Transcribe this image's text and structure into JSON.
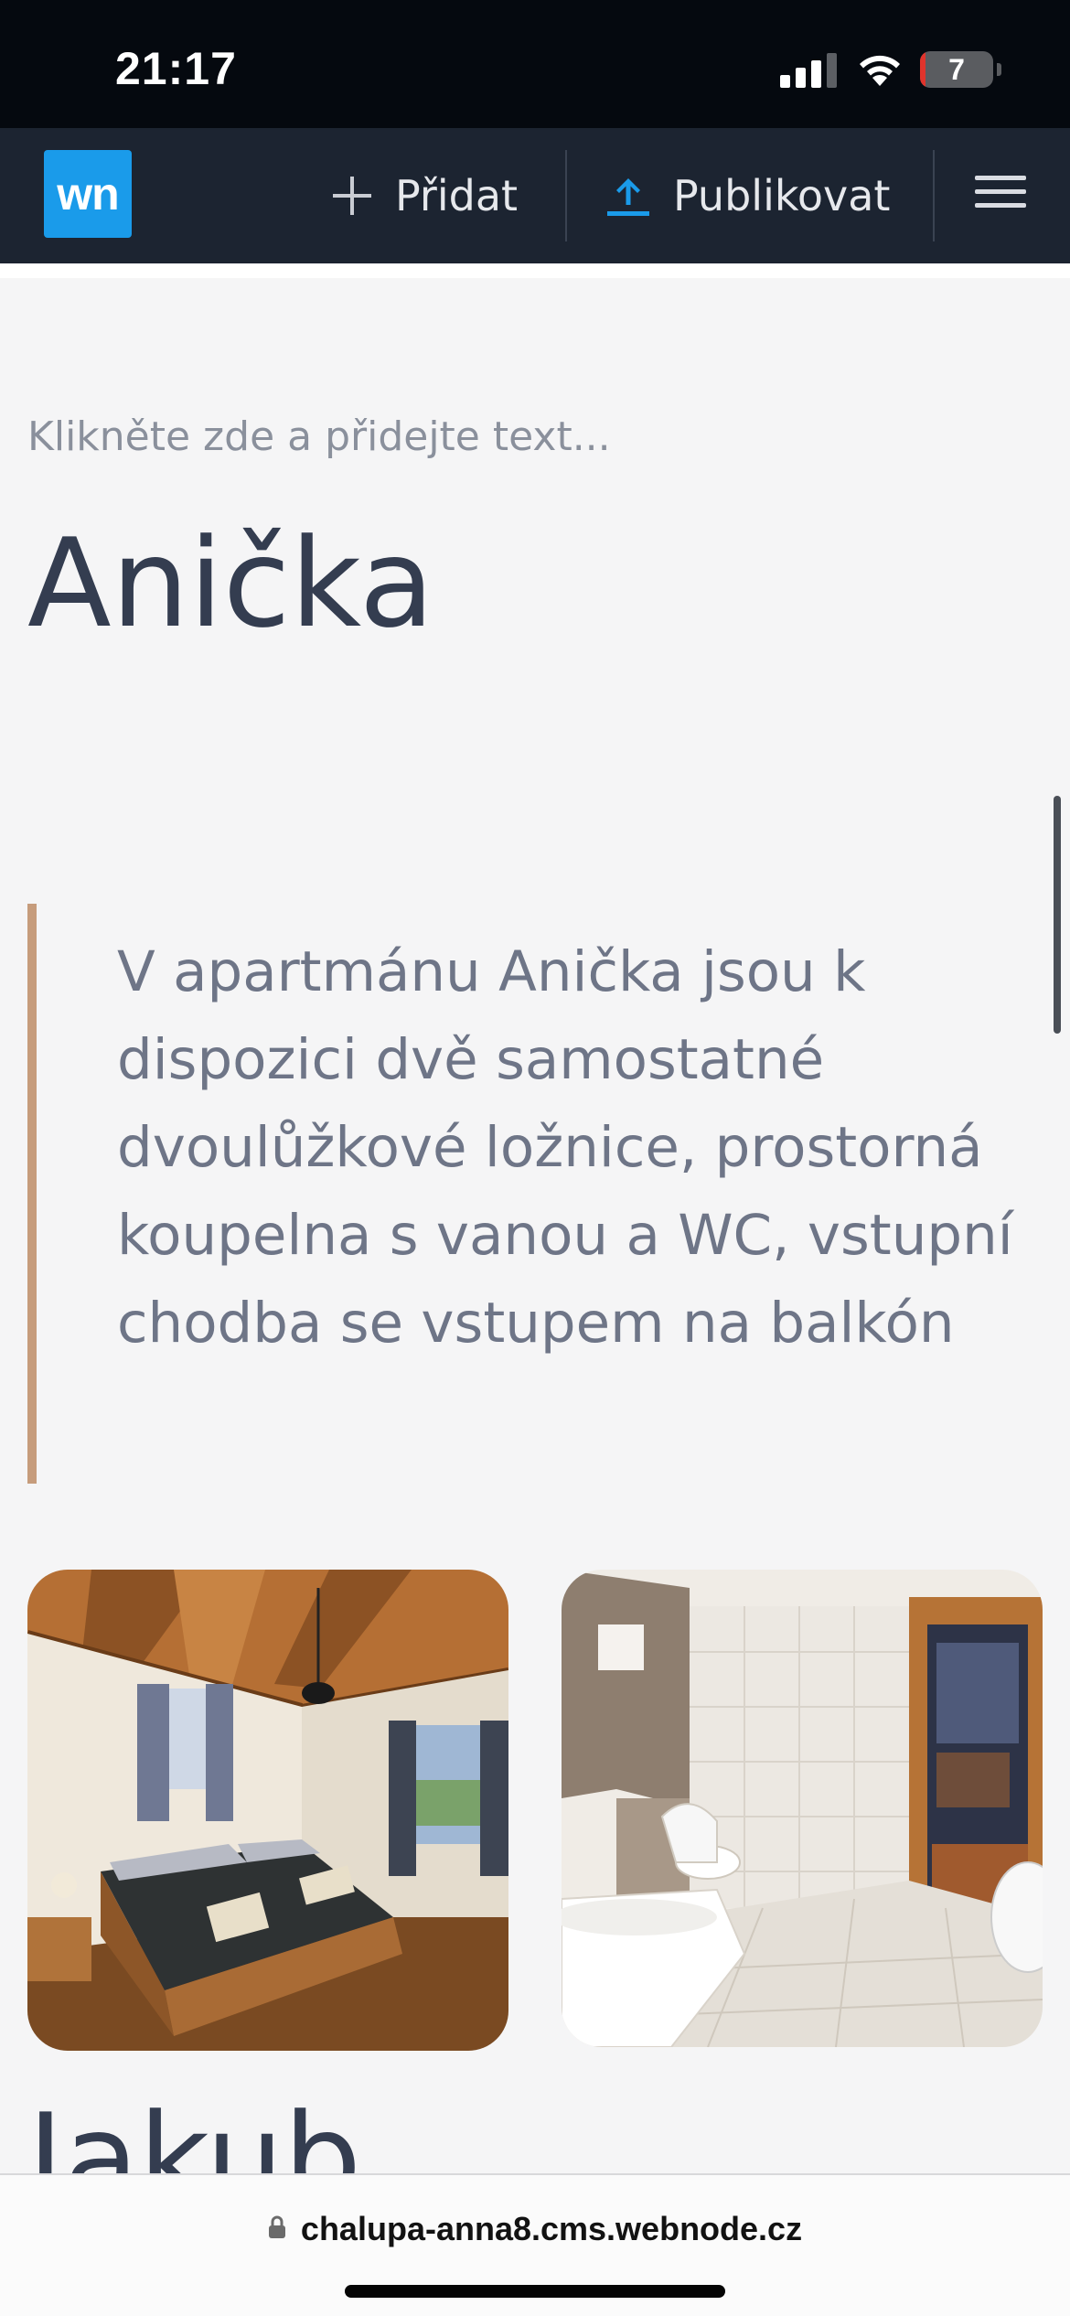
{
  "status_bar": {
    "time": "21:17",
    "battery_level": "7"
  },
  "toolbar": {
    "logo_text": "wn",
    "add_label": "Přidat",
    "publish_label": "Publikovat",
    "accent_color": "#1a9bea"
  },
  "content": {
    "placeholder_text": "Klikněte zde a přidejte text...",
    "title": "Anička",
    "quote": "V apartmánu Anička jsou k dispozici dvě samostatné dvoulůžkové ložnice, prostorná koupelna s vanou a WC, vstupní chodba se vstupem na balkón",
    "next_title": "Jakub",
    "quote_accent_color": "#c69c7c"
  },
  "browser": {
    "url": "chalupa-anna8.cms.webnode.cz"
  }
}
